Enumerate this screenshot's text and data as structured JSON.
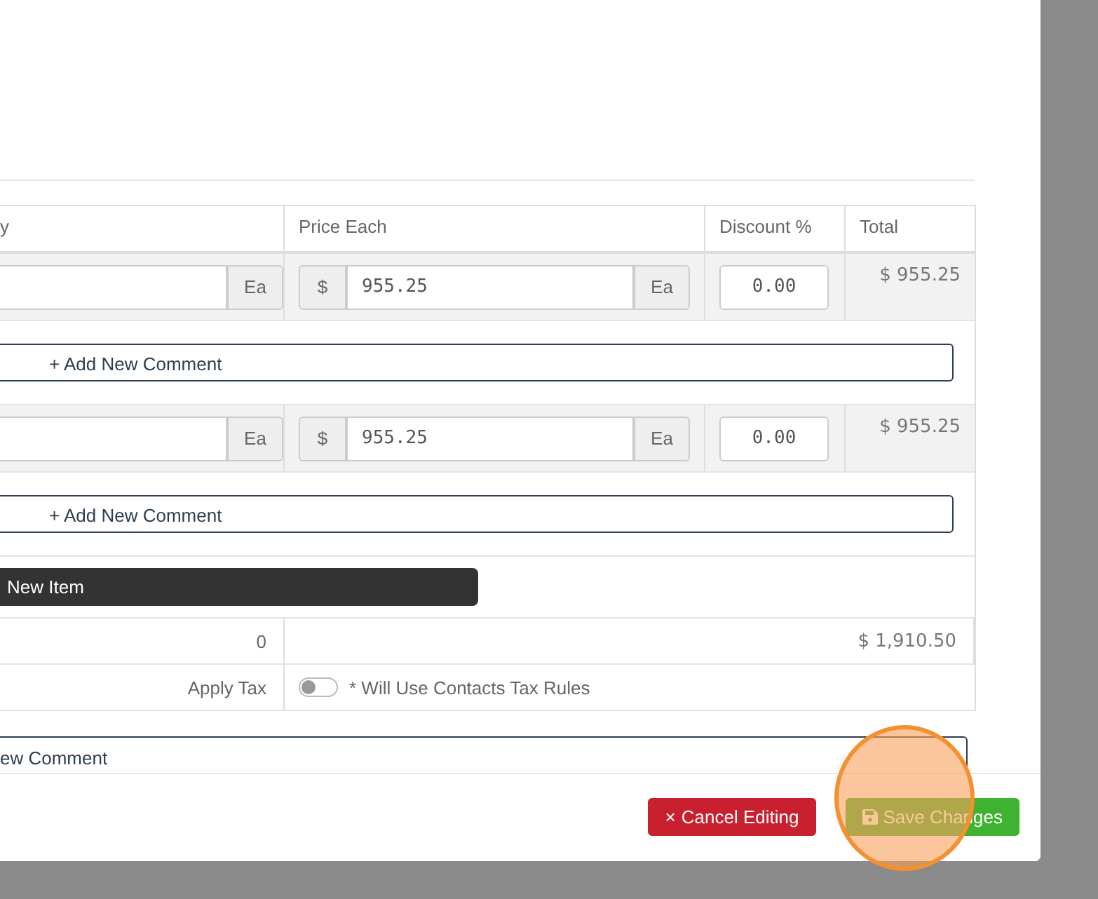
{
  "table": {
    "columns": [
      {
        "label": "y"
      },
      {
        "label": "Price Each"
      },
      {
        "label": "Discount %"
      },
      {
        "label": "Total"
      }
    ],
    "rows": [
      {
        "unit": "Ea",
        "currency": "$",
        "price": "955.25",
        "price_unit": "Ea",
        "discount": "0.00",
        "total": "$ 955.25",
        "comment_button": "+ Add New Comment"
      },
      {
        "unit": "Ea",
        "currency": "$",
        "price": "955.25",
        "price_unit": "Ea",
        "discount": "0.00",
        "total": "$ 955.25",
        "comment_button": "+ Add New Comment"
      }
    ],
    "add_item_button": "New Item",
    "quantity_total": "0",
    "grand_total": "$ 1,910.50",
    "tax": {
      "label": "Apply Tax",
      "on": false,
      "note": "* Will Use Contacts Tax Rules"
    }
  },
  "comment_button": "ew Comment",
  "footer": {
    "buttons": [
      {
        "kind": "cancel",
        "icon": "×",
        "label": "Cancel Editing"
      },
      {
        "kind": "save",
        "label": "Save Changes"
      }
    ]
  }
}
